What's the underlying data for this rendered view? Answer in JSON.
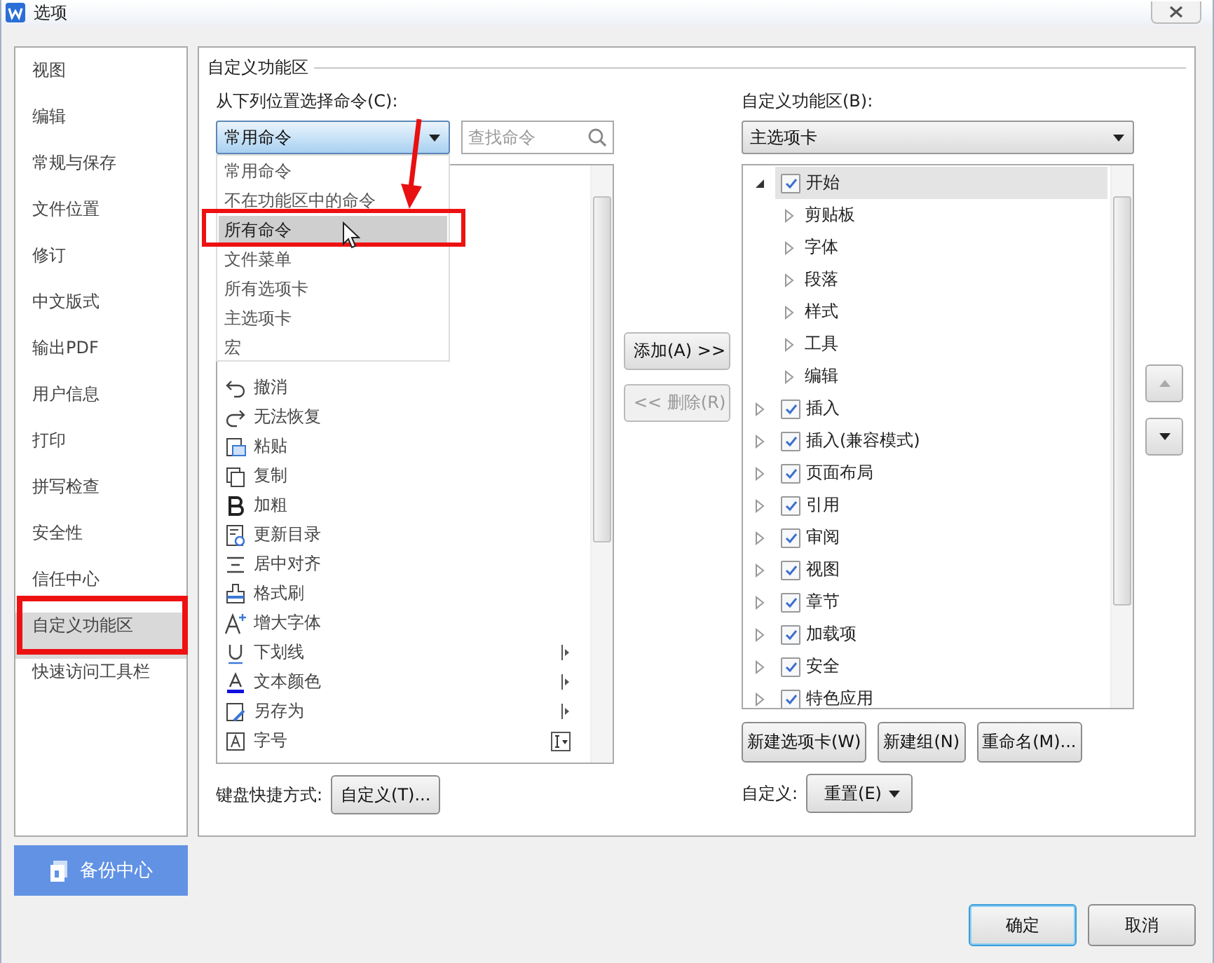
{
  "window": {
    "title": "选项"
  },
  "sidebar": {
    "items": [
      {
        "label": "视图",
        "selected": false
      },
      {
        "label": "编辑",
        "selected": false
      },
      {
        "label": "常规与保存",
        "selected": false
      },
      {
        "label": "文件位置",
        "selected": false
      },
      {
        "label": "修订",
        "selected": false
      },
      {
        "label": "中文版式",
        "selected": false
      },
      {
        "label": "输出PDF",
        "selected": false
      },
      {
        "label": "用户信息",
        "selected": false
      },
      {
        "label": "打印",
        "selected": false
      },
      {
        "label": "拼写检查",
        "selected": false
      },
      {
        "label": "安全性",
        "selected": false
      },
      {
        "label": "信任中心",
        "selected": false
      },
      {
        "label": "自定义功能区",
        "selected": true
      },
      {
        "label": "快速访问工具栏",
        "selected": false
      }
    ],
    "backup_button": "备份中心"
  },
  "section_title": "自定义功能区",
  "commands": {
    "label": "从下列位置选择命令(C):",
    "source": "常用命令",
    "search": {
      "placeholder": "查找命令"
    },
    "dropdown_options": [
      {
        "label": "常用命令",
        "selected": false
      },
      {
        "label": "不在功能区中的命令",
        "selected": false
      },
      {
        "label": "所有命令",
        "selected": true
      },
      {
        "label": "文件菜单",
        "selected": false
      },
      {
        "label": "所有选项卡",
        "selected": false
      },
      {
        "label": "主选项卡",
        "selected": false
      },
      {
        "label": "宏",
        "selected": false
      }
    ],
    "items": [
      {
        "label": "撤消",
        "kind": "plain"
      },
      {
        "label": "无法恢复",
        "kind": "plain"
      },
      {
        "label": "粘贴",
        "kind": "plain"
      },
      {
        "label": "复制",
        "kind": "plain"
      },
      {
        "label": "加粗",
        "kind": "plain"
      },
      {
        "label": "更新目录",
        "kind": "plain"
      },
      {
        "label": "居中对齐",
        "kind": "plain"
      },
      {
        "label": "格式刷",
        "kind": "plain"
      },
      {
        "label": "增大字体",
        "kind": "plain"
      },
      {
        "label": "下划线",
        "kind": "submenu"
      },
      {
        "label": "文本颜色",
        "kind": "submenu"
      },
      {
        "label": "另存为",
        "kind": "submenu"
      },
      {
        "label": "字号",
        "kind": "dropdown"
      }
    ],
    "shortcut_label": "键盘快捷方式:",
    "shortcut_button": "自定义(T)..."
  },
  "transfer_buttons": [
    {
      "label": "添加(A) >>",
      "disabled": false
    },
    {
      "label": "<< 删除(R)",
      "disabled": true
    }
  ],
  "ribbon": {
    "label": "自定义功能区(B):",
    "scope": "主选项卡",
    "tree": [
      {
        "label": "开始",
        "checked": true,
        "expanded": true,
        "selected": true,
        "children": [
          {
            "label": "剪贴板",
            "expanded": false
          },
          {
            "label": "字体",
            "expanded": false
          },
          {
            "label": "段落",
            "expanded": false
          },
          {
            "label": "样式",
            "expanded": false
          },
          {
            "label": "工具",
            "expanded": false
          },
          {
            "label": "编辑",
            "expanded": false
          }
        ]
      },
      {
        "label": "插入",
        "checked": true,
        "expanded": false,
        "selected": false
      },
      {
        "label": "插入(兼容模式)",
        "checked": true,
        "expanded": false,
        "selected": false
      },
      {
        "label": "页面布局",
        "checked": true,
        "expanded": false,
        "selected": false
      },
      {
        "label": "引用",
        "checked": true,
        "expanded": false,
        "selected": false
      },
      {
        "label": "审阅",
        "checked": true,
        "expanded": false,
        "selected": false
      },
      {
        "label": "视图",
        "checked": true,
        "expanded": false,
        "selected": false
      },
      {
        "label": "章节",
        "checked": true,
        "expanded": false,
        "selected": false
      },
      {
        "label": "加载项",
        "checked": true,
        "expanded": false,
        "selected": false
      },
      {
        "label": "安全",
        "checked": true,
        "expanded": false,
        "selected": false
      },
      {
        "label": "特色应用",
        "checked": true,
        "expanded": false,
        "selected": false
      }
    ],
    "buttons": [
      "新建选项卡(W)",
      "新建组(N)",
      "重命名(M)..."
    ],
    "customize_label": "自定义:",
    "reset_button": "重置(E)"
  },
  "dialog_buttons": [
    "确定",
    "取消"
  ]
}
